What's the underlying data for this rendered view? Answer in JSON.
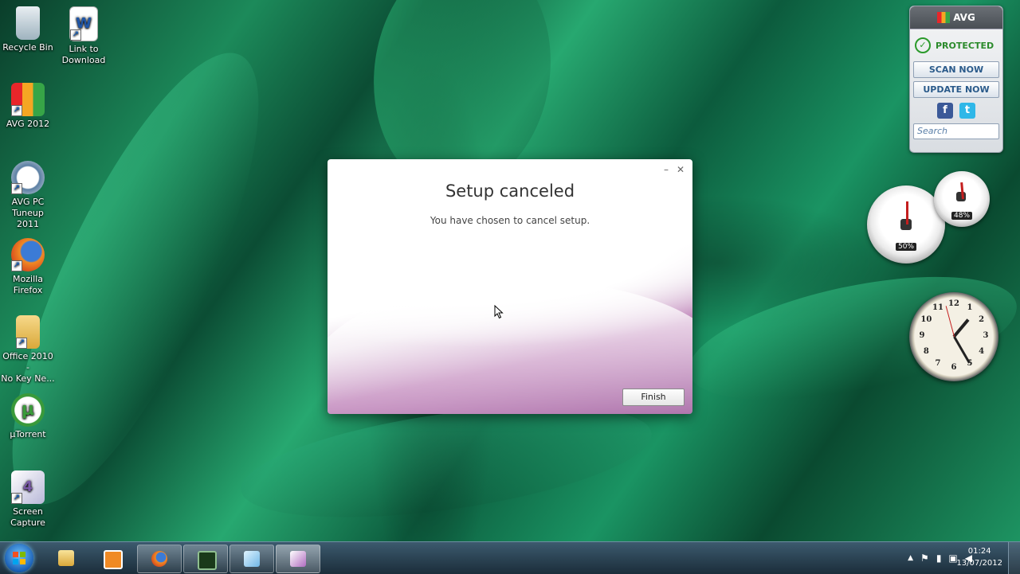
{
  "desktop": {
    "icons": [
      {
        "label": "Recycle Bin",
        "icon": "recycle-bin-icon"
      },
      {
        "label": "Link to\nDownload",
        "icon": "word-document-icon"
      },
      {
        "label": "AVG 2012",
        "icon": "avg-icon"
      },
      {
        "label": "AVG PC\nTuneup 2011",
        "icon": "avg-tuneup-icon"
      },
      {
        "label": "Mozilla\nFirefox",
        "icon": "firefox-icon"
      },
      {
        "label": "Office 2010 -\nNo Key Ne...",
        "icon": "folder-icon"
      },
      {
        "label": "µTorrent",
        "icon": "utorrent-icon"
      },
      {
        "label": "Screen\nCapture",
        "icon": "screen-capture-icon"
      }
    ]
  },
  "dialog": {
    "title": "Setup canceled",
    "message": "You have chosen to cancel setup.",
    "minimize": "–",
    "close": "✕",
    "finish_label": "Finish"
  },
  "avg_gadget": {
    "brand": "AVG",
    "status": "PROTECTED",
    "scan_label": "SCAN NOW",
    "update_label": "UPDATE NOW",
    "facebook": "f",
    "twitter": "t",
    "search_placeholder": "Search"
  },
  "meters": {
    "cpu_percent": "50%",
    "memory_percent": "48%"
  },
  "clock_gadget": {
    "numbers": [
      "12",
      "1",
      "2",
      "3",
      "4",
      "5",
      "6",
      "7",
      "8",
      "9",
      "10",
      "11"
    ]
  },
  "taskbar": {
    "items": [
      {
        "icon": "explorer-folder-icon",
        "active": false
      },
      {
        "icon": "media-player-icon",
        "active": false
      },
      {
        "icon": "firefox-icon",
        "active": true
      },
      {
        "icon": "task-manager-icon",
        "active": true
      },
      {
        "icon": "office-setup-icon",
        "active": true
      },
      {
        "icon": "screen-capture-icon",
        "active": true
      }
    ],
    "tray": {
      "chevron": "▲",
      "time": "01:24",
      "date": "13/07/2012"
    }
  },
  "colors": {
    "avg_green": "#2b8a2b",
    "dialog_purple": "#8e3d8b",
    "taskbar": "#1b2d3a"
  }
}
